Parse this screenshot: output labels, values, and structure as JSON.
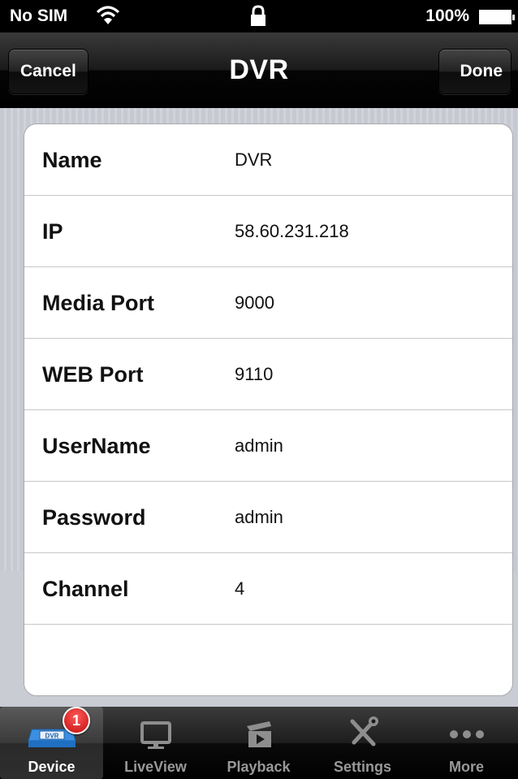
{
  "status_bar": {
    "carrier": "No SIM",
    "battery_text": "100%"
  },
  "nav": {
    "title": "DVR",
    "cancel_label": "Cancel",
    "done_label": "Done"
  },
  "fields": [
    {
      "label": "Name",
      "value": "DVR"
    },
    {
      "label": "IP",
      "value": "58.60.231.218"
    },
    {
      "label": "Media Port",
      "value": "9000"
    },
    {
      "label": "WEB Port",
      "value": "9110"
    },
    {
      "label": "UserName",
      "value": "admin"
    },
    {
      "label": "Password",
      "value": "admin"
    },
    {
      "label": "Channel",
      "value": "4"
    }
  ],
  "tabs": [
    {
      "label": "Device",
      "icon": "dvr-icon",
      "badge": "1",
      "selected": true
    },
    {
      "label": "LiveView",
      "icon": "monitor-icon"
    },
    {
      "label": "Playback",
      "icon": "playback-icon"
    },
    {
      "label": "Settings",
      "icon": "tools-icon"
    },
    {
      "label": "More",
      "icon": "more-dots-icon"
    }
  ],
  "colors": {
    "accent_blue": "#2f7fd6",
    "badge_red": "#d91c1c"
  },
  "icons": {
    "dvr_text": "DVR"
  }
}
